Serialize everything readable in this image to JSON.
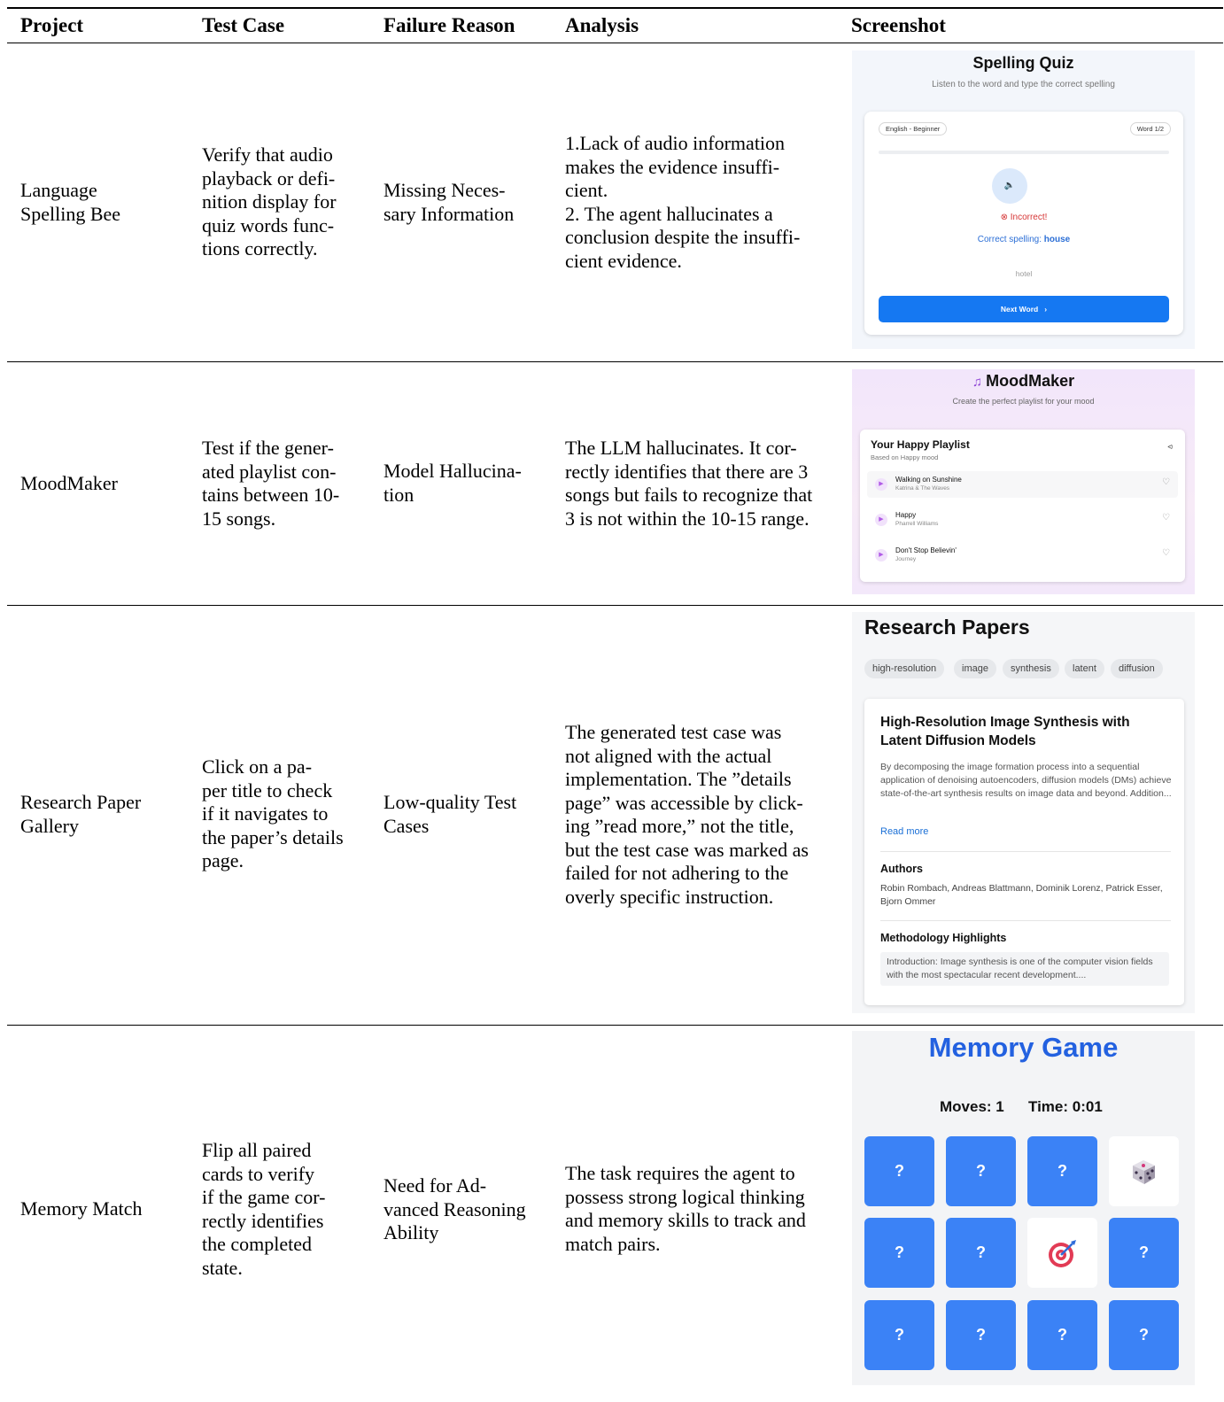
{
  "headers": [
    "Project",
    "Test Case",
    "Failure Reason",
    "Analysis",
    "Screenshot"
  ],
  "rows": [
    {
      "project": [
        "Language",
        "Spelling Bee"
      ],
      "test_case": [
        "Verify that audio",
        "playback or defi-",
        "nition display for",
        "quiz words func-",
        "tions correctly."
      ],
      "failure": [
        "Missing Neces-",
        "sary Information"
      ],
      "analysis": [
        "1.Lack of audio information",
        "makes the evidence insuffi-",
        "cient.",
        "2. The agent hallucinates a",
        "conclusion despite the insuffi-",
        "cient evidence."
      ]
    },
    {
      "project": [
        "MoodMaker"
      ],
      "test_case": [
        "Test if the gener-",
        "ated playlist con-",
        "tains between 10-",
        "15 songs."
      ],
      "failure": [
        "Model Hallucina-",
        "tion"
      ],
      "analysis": [
        "The LLM hallucinates. It cor-",
        "rectly identifies that there are 3",
        "songs but fails to recognize that",
        "3 is not within the 10-15 range."
      ]
    },
    {
      "project": [
        "Research Paper",
        "Gallery"
      ],
      "test_case": [
        "Click on a pa-",
        "per title to check",
        "if it navigates to",
        "the paper’s details",
        "page."
      ],
      "failure": [
        "Low-quality Test",
        "Cases"
      ],
      "analysis": [
        "The generated test case was",
        "not aligned with the actual",
        "implementation. The ”details",
        "page” was accessible by click-",
        "ing ”read more,” not the title,",
        "but the test case was marked as",
        "failed for not adhering to the",
        "overly specific instruction."
      ]
    },
    {
      "project": [
        "Memory Match"
      ],
      "test_case": [
        "Flip all paired",
        "cards to verify",
        "if the game cor-",
        "rectly identifies",
        "the completed",
        "state."
      ],
      "failure": [
        "Need for Ad-",
        "vanced Reasoning",
        "Ability"
      ],
      "analysis": [
        "The task requires the agent to",
        "possess strong logical thinking",
        "and memory skills to track and",
        "match pairs."
      ]
    }
  ],
  "spelling_quiz": {
    "title": "Spelling Quiz",
    "subtitle": "Listen to the word and type the correct spelling",
    "language_badge": "English - Beginner",
    "word_badge": "Word 1/2",
    "incorrect": "Incorrect!",
    "correct_label": "Correct spelling: ",
    "correct_word": "house",
    "answer": "hotel",
    "next_button": "Next Word"
  },
  "moodmaker": {
    "title": "MoodMaker",
    "subtitle": "Create the perfect playlist for your mood",
    "playlist_title": "Your Happy Playlist",
    "playlist_sub": "Based on Happy mood",
    "songs": [
      {
        "title": "Walking on Sunshine",
        "artist": "Katrina & The Waves"
      },
      {
        "title": "Happy",
        "artist": "Pharrell Williams"
      },
      {
        "title": "Don't Stop Believin'",
        "artist": "Journey"
      }
    ]
  },
  "research": {
    "title": "Research Papers",
    "tags": [
      "high-resolution",
      "image",
      "synthesis",
      "latent",
      "diffusion"
    ],
    "paper_title": "High-Resolution Image Synthesis with Latent Diffusion Models",
    "abstract": "By decomposing the image formation process into a sequential application of denoising autoencoders, diffusion models (DMs) achieve state-of-the-art synthesis results on image data and beyond. Addition...",
    "read_more": "Read more",
    "authors_label": "Authors",
    "authors": "Robin Rombach, Andreas Blattmann, Dominik Lorenz, Patrick Esser, Bjorn Ommer",
    "method_label": "Methodology Highlights",
    "method_text": "Introduction: Image synthesis is one of the computer vision fields with the most spectacular recent development...."
  },
  "memory": {
    "title": "Memory Game",
    "moves": "Moves: 1",
    "time": "Time: 0:01",
    "hidden_symbol": "?",
    "cards": [
      "hidden",
      "hidden",
      "hidden",
      "dice",
      "hidden",
      "hidden",
      "target",
      "hidden",
      "hidden",
      "hidden",
      "hidden",
      "hidden"
    ]
  }
}
